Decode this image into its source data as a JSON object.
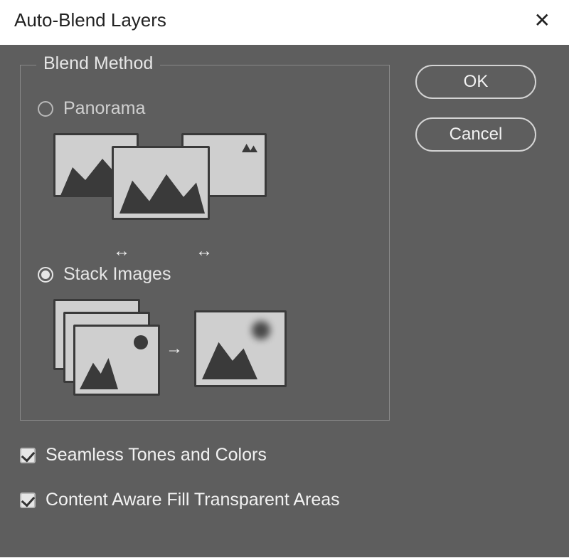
{
  "dialog": {
    "title": "Auto-Blend Layers"
  },
  "group": {
    "title": "Blend Method",
    "options": {
      "panorama": {
        "label": "Panorama",
        "selected": false
      },
      "stack": {
        "label": "Stack Images",
        "selected": true
      }
    }
  },
  "checks": {
    "seamless": {
      "label": "Seamless Tones and Colors",
      "checked": true
    },
    "caf": {
      "label": "Content Aware Fill Transparent Areas",
      "checked": true
    }
  },
  "buttons": {
    "ok": "OK",
    "cancel": "Cancel"
  }
}
